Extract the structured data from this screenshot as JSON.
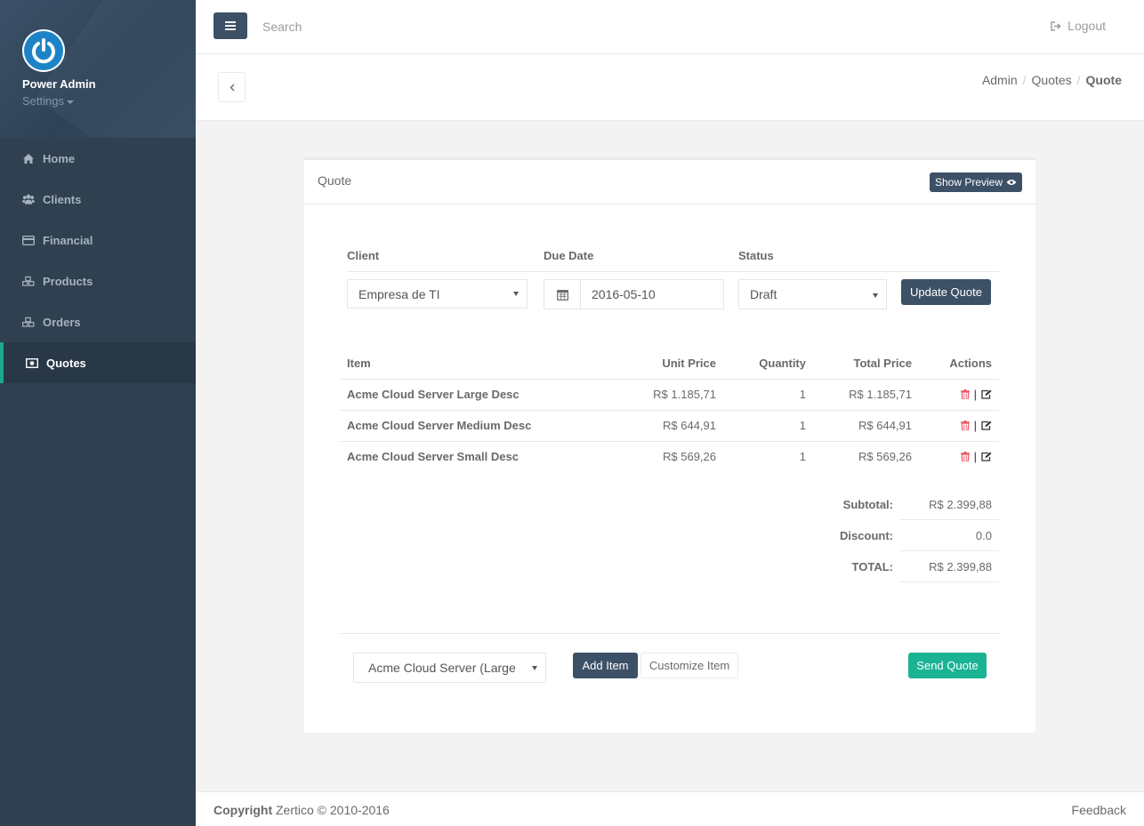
{
  "profile": {
    "name": "Power Admin",
    "settings_label": "Settings"
  },
  "sidebar": {
    "items": [
      {
        "label": "Home",
        "icon": "home-icon"
      },
      {
        "label": "Clients",
        "icon": "users-icon"
      },
      {
        "label": "Financial",
        "icon": "credit-card-icon"
      },
      {
        "label": "Products",
        "icon": "cubes-icon"
      },
      {
        "label": "Orders",
        "icon": "cubes-icon"
      },
      {
        "label": "Quotes",
        "icon": "money-icon",
        "active": true
      }
    ]
  },
  "topbar": {
    "search_placeholder": "Search",
    "logout_label": "Logout"
  },
  "breadcrumb": {
    "items": [
      "Admin",
      "Quotes"
    ],
    "current": "Quote"
  },
  "panel": {
    "title": "Quote",
    "preview_label": "Show Preview"
  },
  "form": {
    "client_label": "Client",
    "due_date_label": "Due Date",
    "status_label": "Status",
    "client_value": "Empresa de TI",
    "due_date_value": "2016-05-10",
    "status_value": "Draft",
    "update_label": "Update Quote"
  },
  "table": {
    "headers": {
      "item": "Item",
      "unit_price": "Unit Price",
      "quantity": "Quantity",
      "total_price": "Total Price",
      "actions": "Actions"
    },
    "rows": [
      {
        "item": "Acme Cloud Server Large Desc",
        "unit_price": "R$ 1.185,71",
        "quantity": "1",
        "total_price": "R$ 1.185,71"
      },
      {
        "item": "Acme Cloud Server Medium Desc",
        "unit_price": "R$ 644,91",
        "quantity": "1",
        "total_price": "R$ 644,91"
      },
      {
        "item": "Acme Cloud Server Small Desc",
        "unit_price": "R$ 569,26",
        "quantity": "1",
        "total_price": "R$ 569,26"
      }
    ],
    "action_separator": "|"
  },
  "totals": {
    "subtotal_label": "Subtotal:",
    "subtotal_value": "R$ 2.399,88",
    "discount_label": "Discount:",
    "discount_value": "0.0",
    "total_label": "TOTAL:",
    "total_value": "R$ 2.399,88"
  },
  "add_item": {
    "product_value": "Acme Cloud Server (Large",
    "add_label": "Add Item",
    "customize_label": "Customize Item",
    "send_label": "Send Quote"
  },
  "footer": {
    "copyright_bold": "Copyright",
    "copyright_text": "Zertico © 2010-2016",
    "feedback_label": "Feedback"
  },
  "colors": {
    "sidebar": "#2f4050",
    "primary_dark": "#3c5066",
    "accent_green": "#1ab394",
    "danger": "#ed5565",
    "logo_blue": "#1c84c6"
  }
}
